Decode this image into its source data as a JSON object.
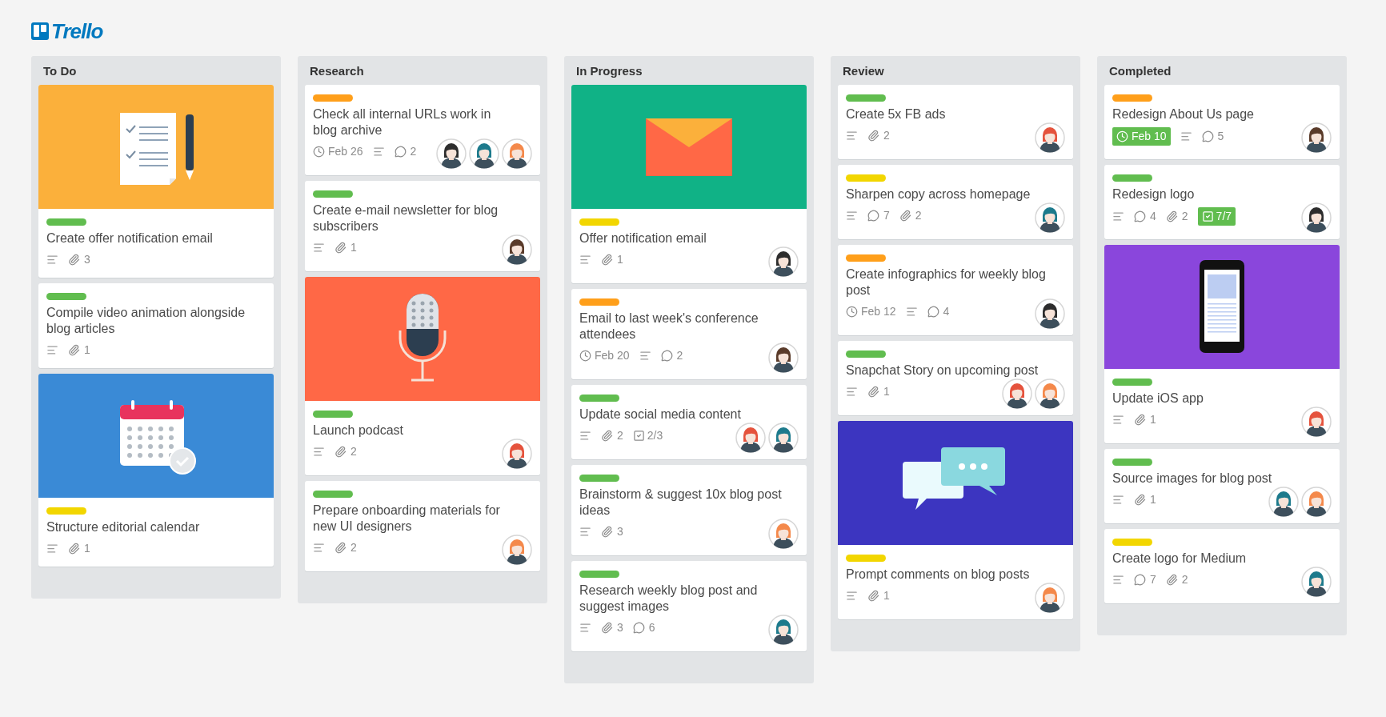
{
  "logo": {
    "text": "Trello"
  },
  "lists": [
    {
      "title": "To Do",
      "cards": [
        {
          "cover": {
            "kind": "checklist",
            "color": "#fbb03b"
          },
          "label": {
            "color": "#61bd4f"
          },
          "title": "Create offer notification email",
          "badges": [
            {
              "kind": "description"
            },
            {
              "kind": "attachments",
              "text": "3"
            }
          ]
        },
        {
          "label": {
            "color": "#61bd4f"
          },
          "title": "Compile video animation alongside blog articles",
          "badges": [
            {
              "kind": "description"
            },
            {
              "kind": "attachments",
              "text": "1"
            }
          ]
        },
        {
          "cover": {
            "kind": "calendar",
            "color": "#3a8ad6"
          },
          "label": {
            "color": "#f2d600"
          },
          "title": "Structure editorial calendar",
          "badges": [
            {
              "kind": "description"
            },
            {
              "kind": "attachments",
              "text": "1"
            }
          ]
        }
      ]
    },
    {
      "title": "Research",
      "cards": [
        {
          "label": {
            "color": "#ff9f1a"
          },
          "title": "Check all internal URLs work in blog archive",
          "badges": [
            {
              "kind": "due",
              "text": "Feb 26",
              "done": false
            },
            {
              "kind": "description"
            },
            {
              "kind": "comments",
              "text": "2"
            }
          ],
          "members": [
            {
              "color": "#2d2d2d"
            },
            {
              "color": "#1d7a8c"
            },
            {
              "color": "#f4894b"
            }
          ]
        },
        {
          "label": {
            "color": "#61bd4f"
          },
          "title": "Create e-mail newsletter for blog subscribers",
          "badges": [
            {
              "kind": "description"
            },
            {
              "kind": "attachments",
              "text": "1"
            }
          ],
          "members": [
            {
              "color": "#5a3b2a"
            }
          ]
        },
        {
          "cover": {
            "kind": "microphone",
            "color": "#ff6846"
          },
          "label": {
            "color": "#61bd4f"
          },
          "title": "Launch podcast",
          "badges": [
            {
              "kind": "description"
            },
            {
              "kind": "attachments",
              "text": "2"
            }
          ],
          "members": [
            {
              "color": "#e5533d"
            }
          ]
        },
        {
          "label": {
            "color": "#61bd4f"
          },
          "title": "Prepare onboarding materials for new UI designers",
          "badges": [
            {
              "kind": "description"
            },
            {
              "kind": "attachments",
              "text": "2"
            }
          ],
          "members": [
            {
              "color": "#f4894b"
            }
          ]
        }
      ]
    },
    {
      "title": "In Progress",
      "cards": [
        {
          "cover": {
            "kind": "envelope",
            "color": "#10b286"
          },
          "label": {
            "color": "#f2d600"
          },
          "title": "Offer notification email",
          "badges": [
            {
              "kind": "description"
            },
            {
              "kind": "attachments",
              "text": "1"
            }
          ],
          "members": [
            {
              "color": "#2d2d2d"
            }
          ]
        },
        {
          "label": {
            "color": "#ff9f1a"
          },
          "title": "Email to last week's conference attendees",
          "badges": [
            {
              "kind": "due",
              "text": "Feb 20",
              "done": false
            },
            {
              "kind": "description"
            },
            {
              "kind": "comments",
              "text": "2"
            }
          ],
          "members": [
            {
              "color": "#5a3b2a"
            }
          ]
        },
        {
          "label": {
            "color": "#61bd4f"
          },
          "title": "Update social media content",
          "badges": [
            {
              "kind": "description"
            },
            {
              "kind": "attachments",
              "text": "2"
            },
            {
              "kind": "checklist",
              "text": "2/3",
              "complete": false
            }
          ],
          "members": [
            {
              "color": "#e5533d"
            },
            {
              "color": "#1d7a8c"
            }
          ]
        },
        {
          "label": {
            "color": "#61bd4f"
          },
          "title": "Brainstorm & suggest 10x blog post ideas",
          "badges": [
            {
              "kind": "description"
            },
            {
              "kind": "attachments",
              "text": "3"
            }
          ],
          "members": [
            {
              "color": "#f4894b"
            }
          ]
        },
        {
          "label": {
            "color": "#61bd4f"
          },
          "title": "Research weekly blog post and suggest images",
          "badges": [
            {
              "kind": "description"
            },
            {
              "kind": "attachments",
              "text": "3"
            },
            {
              "kind": "comments",
              "text": "6"
            }
          ],
          "members": [
            {
              "color": "#1d7a8c"
            }
          ]
        }
      ]
    },
    {
      "title": "Review",
      "cards": [
        {
          "label": {
            "color": "#61bd4f"
          },
          "title": "Create 5x FB ads",
          "badges": [
            {
              "kind": "description"
            },
            {
              "kind": "attachments",
              "text": "2"
            }
          ],
          "members": [
            {
              "color": "#e5533d"
            }
          ]
        },
        {
          "label": {
            "color": "#f2d600"
          },
          "title": "Sharpen copy across homepage",
          "badges": [
            {
              "kind": "description"
            },
            {
              "kind": "comments",
              "text": "7"
            },
            {
              "kind": "attachments",
              "text": "2"
            }
          ],
          "members": [
            {
              "color": "#1d7a8c"
            }
          ]
        },
        {
          "label": {
            "color": "#ff9f1a"
          },
          "title": "Create infographics for weekly blog post",
          "badges": [
            {
              "kind": "due",
              "text": "Feb 12",
              "done": false
            },
            {
              "kind": "description"
            },
            {
              "kind": "comments",
              "text": "4"
            }
          ],
          "members": [
            {
              "color": "#2d2d2d"
            }
          ]
        },
        {
          "label": {
            "color": "#61bd4f"
          },
          "title": "Snapchat Story on upcoming post",
          "badges": [
            {
              "kind": "description"
            },
            {
              "kind": "attachments",
              "text": "1"
            }
          ],
          "members": [
            {
              "color": "#e5533d"
            },
            {
              "color": "#f4894b"
            }
          ]
        },
        {
          "cover": {
            "kind": "chat",
            "color": "#3c35c0"
          },
          "label": {
            "color": "#f2d600"
          },
          "title": "Prompt comments on blog posts",
          "badges": [
            {
              "kind": "description"
            },
            {
              "kind": "attachments",
              "text": "1"
            }
          ],
          "members": [
            {
              "color": "#f4894b"
            }
          ]
        }
      ]
    },
    {
      "title": "Completed",
      "cards": [
        {
          "label": {
            "color": "#ff9f1a"
          },
          "title": "Redesign About Us page",
          "badges": [
            {
              "kind": "due",
              "text": "Feb 10",
              "done": true
            },
            {
              "kind": "description"
            },
            {
              "kind": "comments",
              "text": "5"
            }
          ],
          "members": [
            {
              "color": "#5a3b2a"
            }
          ]
        },
        {
          "label": {
            "color": "#61bd4f"
          },
          "title": "Redesign logo",
          "badges": [
            {
              "kind": "description"
            },
            {
              "kind": "comments",
              "text": "4"
            },
            {
              "kind": "attachments",
              "text": "2"
            },
            {
              "kind": "checklist",
              "text": "7/7",
              "complete": true
            }
          ],
          "members": [
            {
              "color": "#2d2d2d"
            }
          ]
        },
        {
          "cover": {
            "kind": "phone",
            "color": "#8a46dc"
          },
          "label": {
            "color": "#61bd4f"
          },
          "title": "Update iOS app",
          "badges": [
            {
              "kind": "description"
            },
            {
              "kind": "attachments",
              "text": "1"
            }
          ],
          "members": [
            {
              "color": "#e5533d"
            }
          ]
        },
        {
          "label": {
            "color": "#61bd4f"
          },
          "title": "Source images for blog post",
          "badges": [
            {
              "kind": "description"
            },
            {
              "kind": "attachments",
              "text": "1"
            }
          ],
          "members": [
            {
              "color": "#1d7a8c"
            },
            {
              "color": "#f4894b"
            }
          ]
        },
        {
          "label": {
            "color": "#f2d600"
          },
          "title": "Create logo for Medium",
          "badges": [
            {
              "kind": "description"
            },
            {
              "kind": "comments",
              "text": "7"
            },
            {
              "kind": "attachments",
              "text": "2"
            }
          ],
          "members": [
            {
              "color": "#1d7a8c"
            }
          ]
        }
      ]
    }
  ]
}
